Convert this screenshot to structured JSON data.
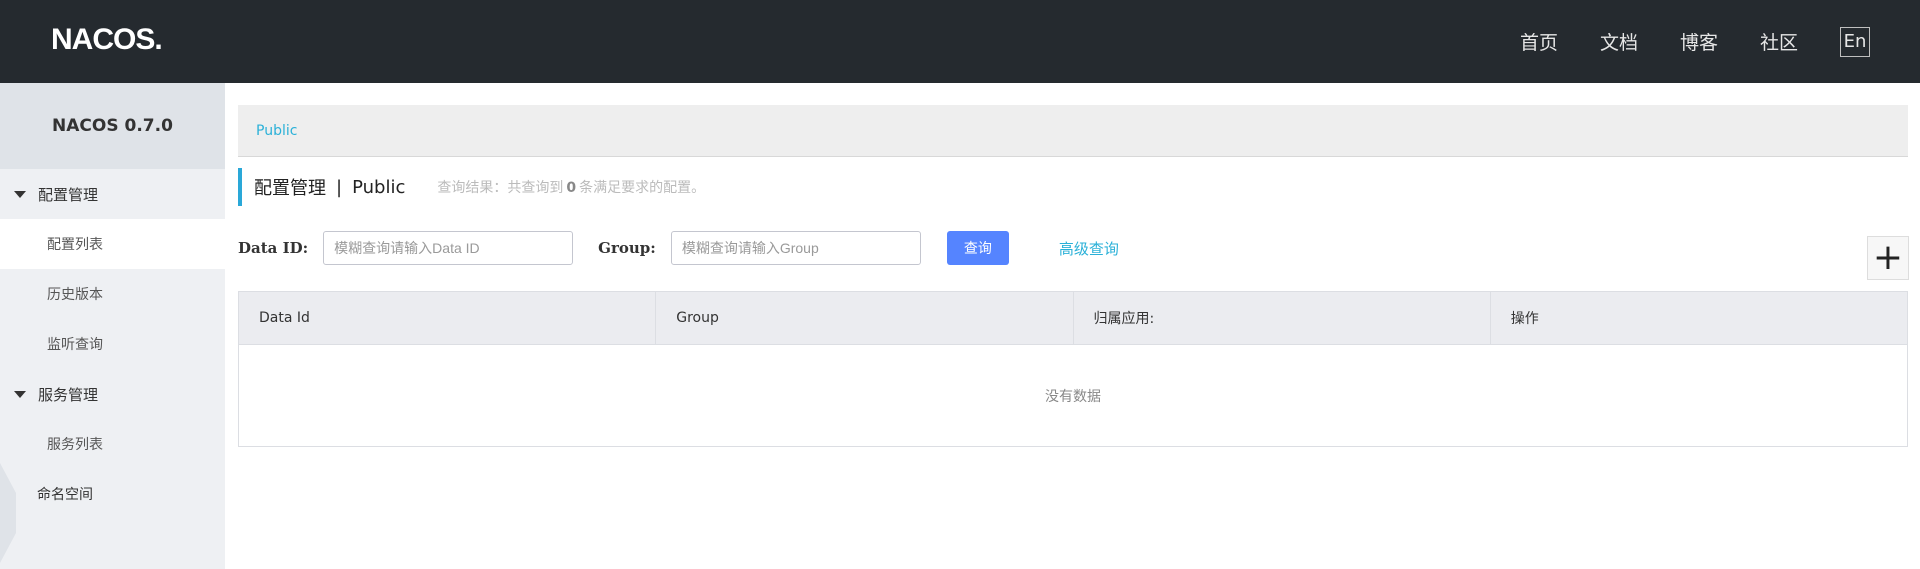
{
  "header": {
    "logo_text": "NACOS.",
    "nav": [
      {
        "label": "首页"
      },
      {
        "label": "文档"
      },
      {
        "label": "博客"
      },
      {
        "label": "社区"
      }
    ],
    "lang_label": "En"
  },
  "sidebar": {
    "title": "NACOS 0.7.0",
    "groups": [
      {
        "label": "配置管理",
        "items": [
          {
            "label": "配置列表"
          },
          {
            "label": "历史版本"
          },
          {
            "label": "监听查询"
          }
        ]
      },
      {
        "label": "服务管理",
        "items": [
          {
            "label": "服务列表"
          }
        ]
      }
    ],
    "top_item": "命名空间"
  },
  "breadcrumb": {
    "label": "Public"
  },
  "page": {
    "title": "配置管理",
    "separator": "|",
    "namespace": "Public",
    "result_prefix": "查询结果：共查询到",
    "result_count": "0",
    "result_suffix": "条满足要求的配置。"
  },
  "search": {
    "data_id_label": "Data ID:",
    "data_id_placeholder": "模糊查询请输入Data ID",
    "group_label": "Group:",
    "group_placeholder": "模糊查询请输入Group",
    "button": "查询",
    "advanced": "高级查询",
    "add_symbol": "+"
  },
  "table": {
    "columns": [
      "Data Id",
      "Group",
      "归属应用:",
      "操作"
    ],
    "empty_text": "没有数据"
  }
}
